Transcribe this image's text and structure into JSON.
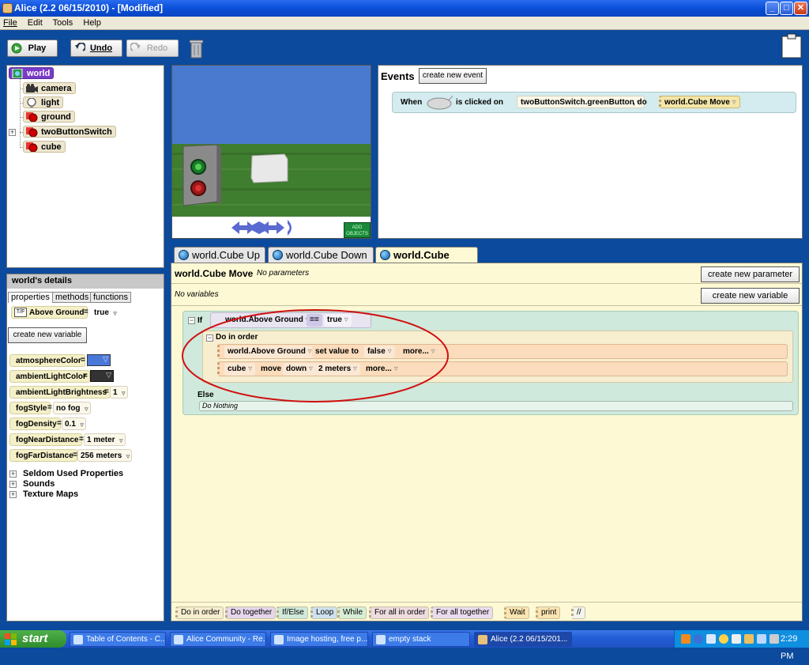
{
  "window": {
    "title": "Alice (2.2  06/15/2010)  - [Modified]",
    "minimize": "_",
    "maximize": "□",
    "close": "✕"
  },
  "menu": [
    "File",
    "Edit",
    "Tools",
    "Help"
  ],
  "toolbar": {
    "play": "Play",
    "undo": "Undo",
    "redo": "Redo"
  },
  "tree": {
    "root": "world",
    "items": [
      "camera",
      "light",
      "ground",
      "twoButtonSwitch",
      "cube"
    ]
  },
  "scene": {
    "add_objects": "ADD OBJECTS"
  },
  "events": {
    "title": "Events",
    "create_button": "create new event",
    "when": "When",
    "is_clicked_on": "is clicked on",
    "target": "twoButtonSwitch.greenButton",
    "do": ", do",
    "method": "world.Cube Move"
  },
  "details": {
    "title": "world's details",
    "tabs": [
      "properties",
      "methods",
      "functions"
    ],
    "var_type": "T/F",
    "var_name": "Above Ground",
    "var_eq": "=",
    "var_value": "true",
    "create_variable": "create new variable",
    "props": [
      {
        "name": "atmosphereColor",
        "value": ""
      },
      {
        "name": "ambientLightColor",
        "value": ""
      },
      {
        "name": "ambientLightBrightness",
        "value": "1"
      },
      {
        "name": "fogStyle",
        "value": "no fog"
      },
      {
        "name": "fogDensity",
        "value": "0.1"
      },
      {
        "name": "fogNearDistance",
        "value": "1 meter"
      },
      {
        "name": "fogFarDistance",
        "value": "256 meters"
      }
    ],
    "groups": [
      "Seldom Used Properties",
      "Sounds",
      "Texture Maps"
    ],
    "colors": {
      "atmosphere": "#4a78d8",
      "ambient": "#333333"
    }
  },
  "editor": {
    "tabs": [
      "world.Cube Up",
      "world.Cube Down",
      "world.Cube Move"
    ],
    "method_name": "world.Cube Move",
    "params": "No parameters",
    "vars": "No variables",
    "create_param": "create new parameter",
    "create_var": "create new variable",
    "if_label": "If",
    "cond_left": "world.Above Ground",
    "cond_op": "==",
    "cond_right": "true",
    "do_in_order": "Do in order",
    "stmt1": {
      "obj": "world.Above Ground",
      "verb": "set value to",
      "value": "false",
      "more": "more..."
    },
    "stmt2": {
      "obj": "cube",
      "verb": "move",
      "dir": "down",
      "amount": "2 meters",
      "more": "more..."
    },
    "else_label": "Else",
    "do_nothing": "Do Nothing"
  },
  "bottom_tiles": [
    "Do in order",
    "Do together",
    "If/Else",
    "Loop",
    "While",
    "For all in order",
    "For all together",
    "Wait",
    "print",
    "//"
  ],
  "taskbar": {
    "start": "start",
    "tasks": [
      "Table of Contents - C...",
      "Alice Community - Re...",
      "Image hosting, free p...",
      "empty stack",
      "Alice (2.2 06/15/201..."
    ],
    "time": "2:29 PM"
  }
}
